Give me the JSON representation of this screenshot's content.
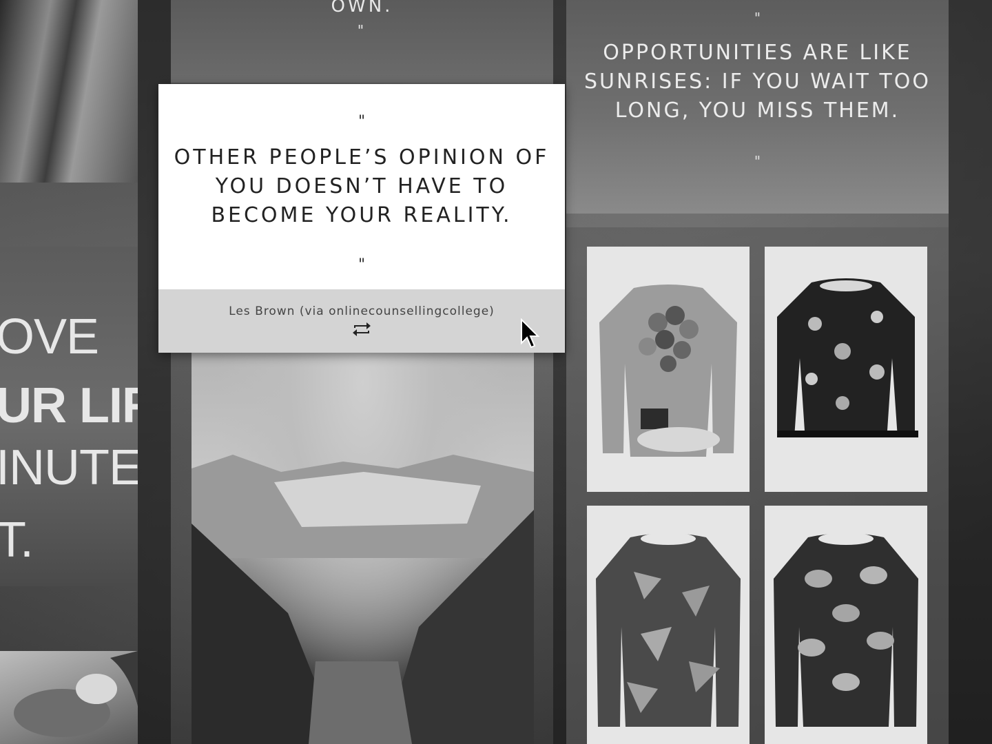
{
  "top_quote": {
    "text": "OWN.",
    "close_mark": "\""
  },
  "right_quote": {
    "open_mark": "\"",
    "text": "OPPORTUNITIES ARE LIKE SUNRISES: IF YOU WAIT TOO LONG, YOU MISS THEM.",
    "close_mark": "\""
  },
  "poster": {
    "lines": [
      "OVE",
      "UR LIFE.",
      "INUTE",
      "T."
    ]
  },
  "card": {
    "open_mark": "\"",
    "text": "OTHER PEOPLE’S OPINION OF YOU DOESN’T HAVE TO BECOME YOUR REALITY.",
    "close_mark": "\"",
    "source": "Les Brown (via onlinecounsellingcollege)",
    "reblog_icon": "reblog-icon"
  },
  "products": [
    {
      "name": "balloon-sweatshirt-image",
      "pattern": "balloons",
      "tone": "#9a9a9a"
    },
    {
      "name": "junk-food-sweatshirt-image",
      "pattern": "fast-food",
      "tone": "#2b2b2b"
    },
    {
      "name": "pizza-sweatshirt-image",
      "pattern": "pizza",
      "tone": "#4a4a4a"
    },
    {
      "name": "burger-sweatshirt-image",
      "pattern": "burgers",
      "tone": "#333333"
    }
  ]
}
